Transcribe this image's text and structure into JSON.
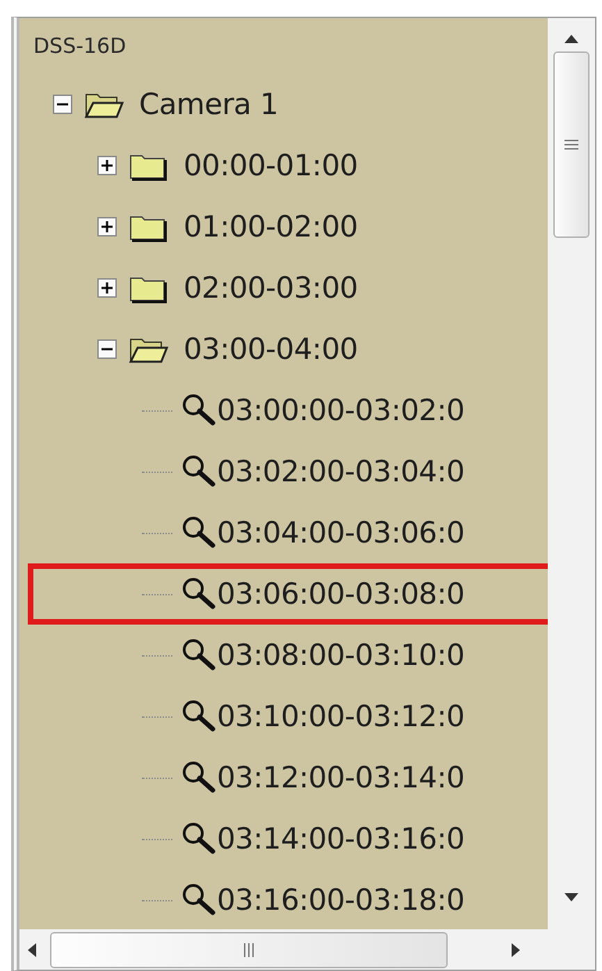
{
  "tree": {
    "title": "DSS-16D",
    "items": [
      {
        "kind": "folder",
        "label": "Camera 1",
        "expanded": true,
        "children": [
          {
            "kind": "folder",
            "label": "00:00-01:00",
            "expanded": false
          },
          {
            "kind": "folder",
            "label": "01:00-02:00",
            "expanded": false
          },
          {
            "kind": "folder",
            "label": "02:00-03:00",
            "expanded": false
          },
          {
            "kind": "folder",
            "label": "03:00-04:00",
            "expanded": true,
            "children": [
              {
                "kind": "clip",
                "label": "03:00:00-03:02:0",
                "highlighted": false
              },
              {
                "kind": "clip",
                "label": "03:02:00-03:04:0",
                "highlighted": false
              },
              {
                "kind": "clip",
                "label": "03:04:00-03:06:0",
                "highlighted": false
              },
              {
                "kind": "clip",
                "label": "03:06:00-03:08:0",
                "highlighted": true
              },
              {
                "kind": "clip",
                "label": "03:08:00-03:10:0",
                "highlighted": false
              },
              {
                "kind": "clip",
                "label": "03:10:00-03:12:0",
                "highlighted": false
              },
              {
                "kind": "clip",
                "label": "03:12:00-03:14:0",
                "highlighted": false
              },
              {
                "kind": "clip",
                "label": "03:14:00-03:16:0",
                "highlighted": false
              },
              {
                "kind": "clip",
                "label": "03:16:00-03:18:0",
                "highlighted": false
              }
            ]
          }
        ]
      }
    ]
  }
}
